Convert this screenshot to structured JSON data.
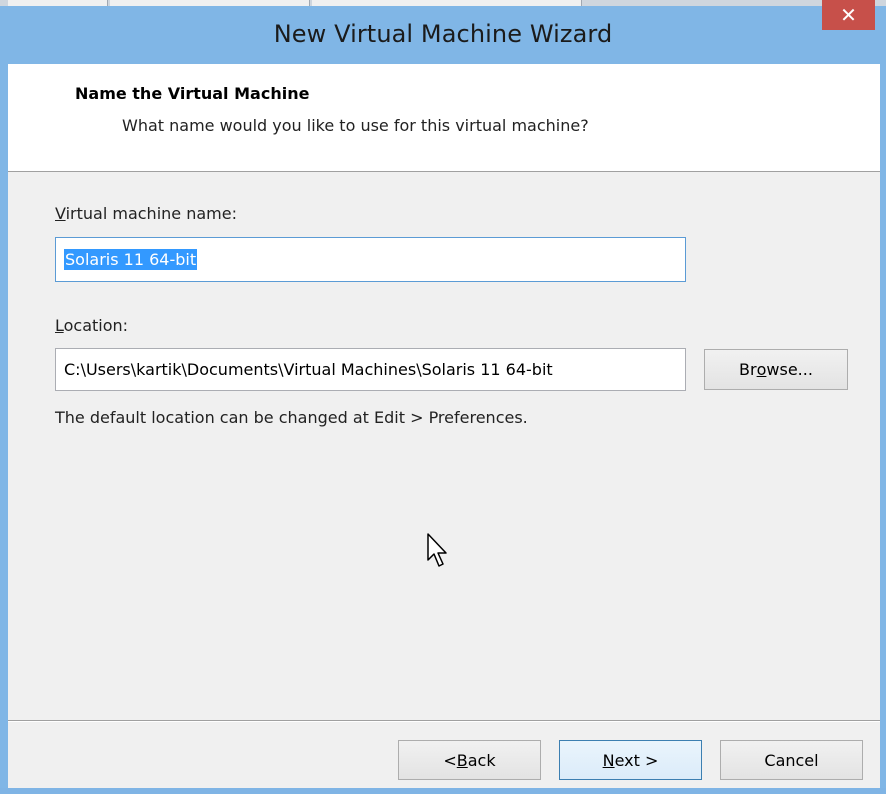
{
  "window": {
    "title": "New Virtual Machine Wizard",
    "close_glyph": "✕"
  },
  "header": {
    "title": "Name the Virtual Machine",
    "subtitle": "What name would you like to use for this virtual machine?"
  },
  "form": {
    "vm_name_label_accel": "V",
    "vm_name_label_rest": "irtual machine name:",
    "vm_name_value": "Solaris 11 64-bit",
    "location_label_accel": "L",
    "location_label_rest": "ocation:",
    "location_value": "C:\\Users\\kartik\\Documents\\Virtual Machines\\Solaris 11 64-bit",
    "browse_pre": "Br",
    "browse_accel": "o",
    "browse_post": "wse...",
    "hint": "The default location can be changed at Edit > Preferences."
  },
  "footer": {
    "back_pre": "< ",
    "back_accel": "B",
    "back_post": "ack",
    "next_accel": "N",
    "next_post": "ext >",
    "cancel": "Cancel"
  },
  "icons": {
    "cursor": "mouse-pointer-icon",
    "close": "close-icon"
  }
}
